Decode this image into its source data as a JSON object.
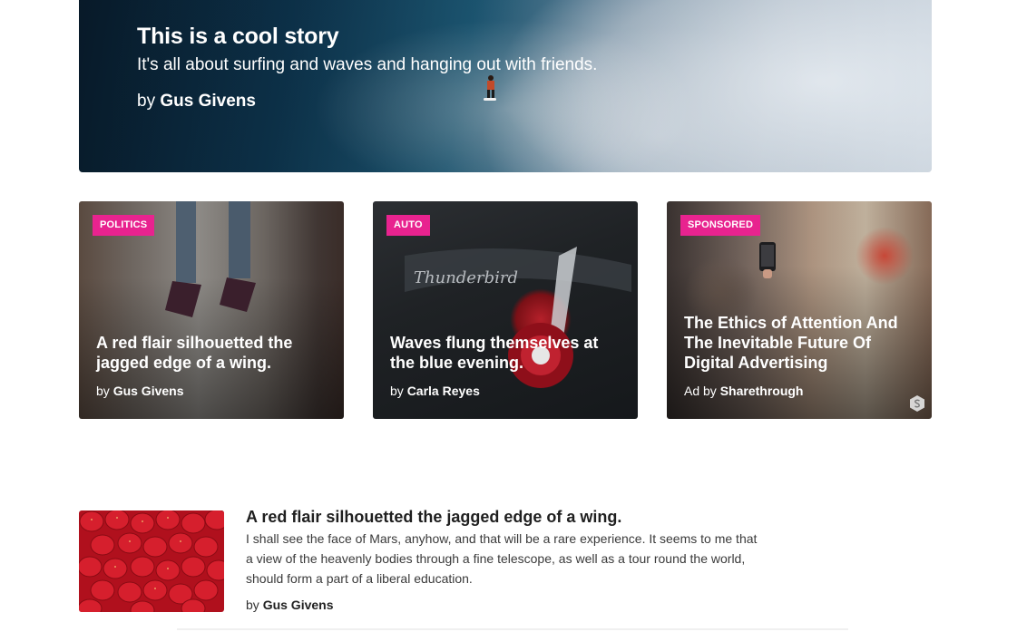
{
  "hero": {
    "title": "This is a cool story",
    "subtitle": "It's all about surfing and waves and hanging out with friends.",
    "by_prefix": "by",
    "author": "Gus Givens"
  },
  "cards": [
    {
      "tag": "POLITICS",
      "title": "A red flair silhouetted the jagged edge of a wing.",
      "by_prefix": "by",
      "author": "Gus Givens"
    },
    {
      "tag": "AUTO",
      "title": "Waves flung themselves at the blue evening.",
      "by_prefix": "by",
      "author": "Carla Reyes"
    },
    {
      "tag": "SPONSORED",
      "title": "The Ethics of Attention And The Inevitable Future Of Digital Advertising",
      "by_prefix": "Ad by",
      "author": "Sharethrough",
      "icon": "sharethrough-icon"
    }
  ],
  "list": {
    "title": "A red flair silhouetted the jagged edge of a wing.",
    "body": "I shall see the face of Mars, anyhow, and that will be a rare experience. It seems to me that a view of the heavenly bodies through a fine telescope, as well as a tour round the world, should form a part of a liberal education.",
    "by_prefix": "by",
    "author": "Gus Givens",
    "thumb_icon": "strawberries-image"
  },
  "colors": {
    "tag_bg": "#e8238f",
    "text": "#222222"
  }
}
